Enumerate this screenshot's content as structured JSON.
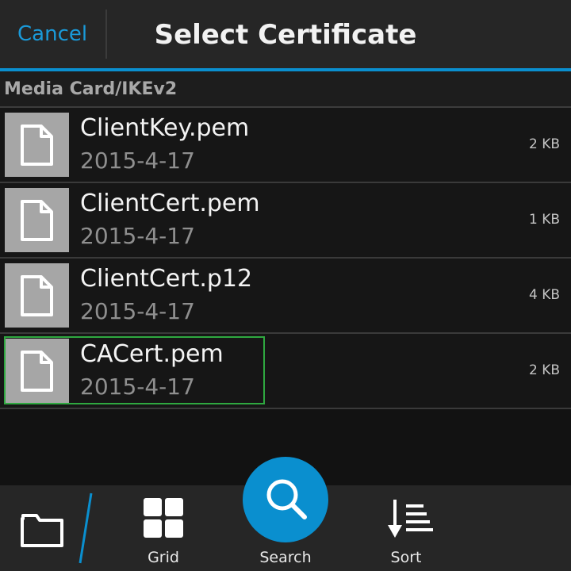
{
  "header": {
    "cancel_label": "Cancel",
    "title": "Select Certificate"
  },
  "path": "Media Card/IKEv2",
  "files": [
    {
      "name": "ClientKey.pem",
      "date": "2015-4-17",
      "size": "2 KB",
      "focused": false
    },
    {
      "name": "ClientCert.pem",
      "date": "2015-4-17",
      "size": "1 KB",
      "focused": false
    },
    {
      "name": "ClientCert.p12",
      "date": "2015-4-17",
      "size": "4 KB",
      "focused": false
    },
    {
      "name": "CACert.pem",
      "date": "2015-4-17",
      "size": "2 KB",
      "focused": true
    }
  ],
  "actions": {
    "grid_label": "Grid",
    "search_label": "Search",
    "sort_label": "Sort"
  },
  "colors": {
    "accent": "#0a8fcf",
    "focus": "#2fa840"
  },
  "icons": [
    "file-icon",
    "folder-icon",
    "grid-icon",
    "search-icon",
    "sort-icon"
  ]
}
